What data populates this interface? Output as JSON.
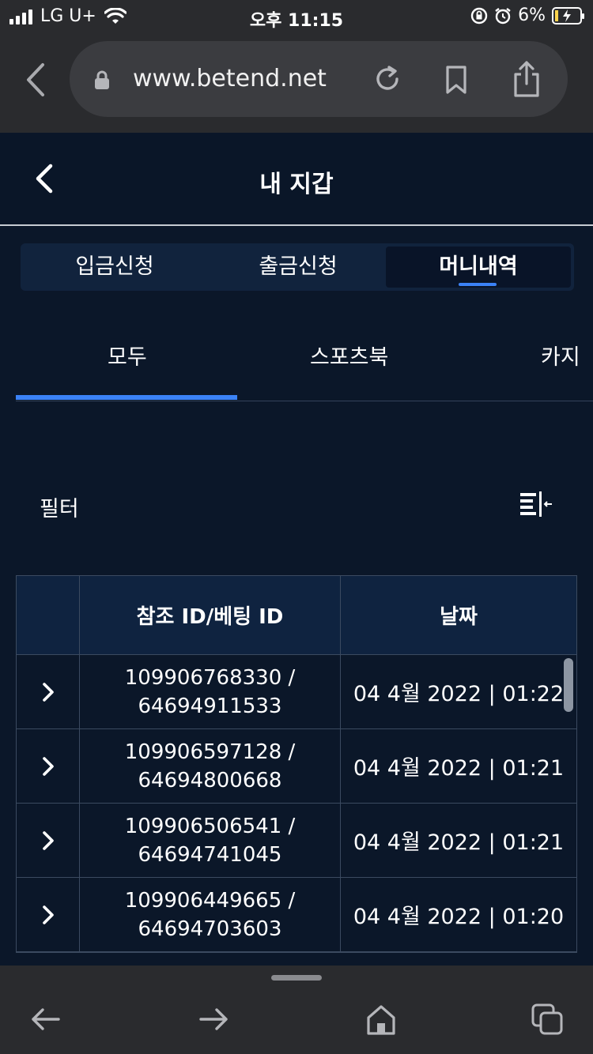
{
  "status_bar": {
    "carrier": "LG U+",
    "time": "오후 11:15",
    "battery": "6%"
  },
  "browser": {
    "url": "www.betend.net"
  },
  "header": {
    "title": "내 지갑"
  },
  "segmented": {
    "items": [
      "입금신청",
      "출금신청",
      "머니내역"
    ],
    "active": "머니내역"
  },
  "subtabs": {
    "items": [
      "모두",
      "스포츠북",
      "카지"
    ],
    "active": "모두"
  },
  "filter": {
    "label": "필터"
  },
  "table": {
    "headers": [
      "",
      "참조 ID/베팅 ID",
      "날짜"
    ],
    "rows": [
      {
        "ref_id": "109906768330 /",
        "bet_id": "64694911533",
        "date": "04 4월 2022 | 01:22"
      },
      {
        "ref_id": "109906597128 /",
        "bet_id": "64694800668",
        "date": "04 4월 2022 | 01:21"
      },
      {
        "ref_id": "109906506541 /",
        "bet_id": "64694741045",
        "date": "04 4월 2022 | 01:21"
      },
      {
        "ref_id": "109906449665 /",
        "bet_id": "64694703603",
        "date": "04 4월 2022 | 01:20"
      }
    ]
  },
  "colors": {
    "page_bg": "#0b1729",
    "accent": "#3b82f6",
    "chrome_bg": "#2a2b2e"
  }
}
